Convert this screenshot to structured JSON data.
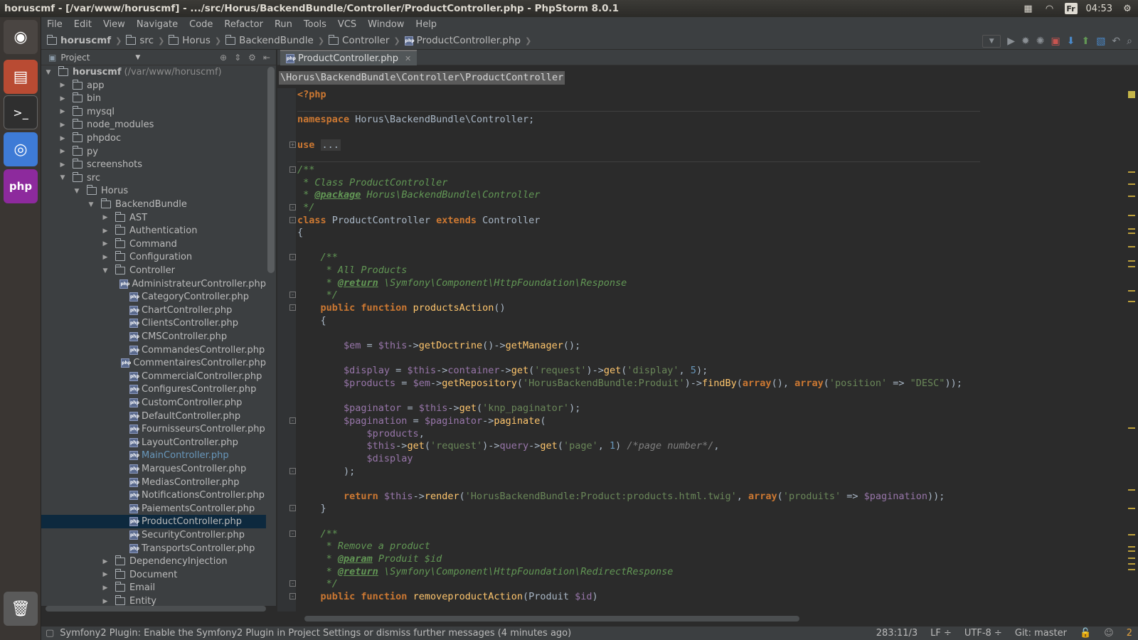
{
  "window": {
    "title": "horuscmf - [/var/www/horuscmf] - .../src/Horus/BackendBundle/Controller/ProductController.php - PhpStorm 8.0.1",
    "clock": "04:53",
    "keyboard": "Fr"
  },
  "menu": [
    "File",
    "Edit",
    "View",
    "Navigate",
    "Code",
    "Refactor",
    "Run",
    "Tools",
    "VCS",
    "Window",
    "Help"
  ],
  "breadcrumbs": [
    "horuscmf",
    "src",
    "Horus",
    "BackendBundle",
    "Controller",
    "ProductController.php"
  ],
  "project": {
    "header": "Project",
    "root_name": "horuscmf",
    "root_path": "(/var/www/horuscmf)"
  },
  "tree": [
    {
      "label": "app",
      "depth": 1,
      "type": "folder",
      "open": false
    },
    {
      "label": "bin",
      "depth": 1,
      "type": "folder",
      "open": false
    },
    {
      "label": "mysql",
      "depth": 1,
      "type": "folder",
      "open": false
    },
    {
      "label": "node_modules",
      "depth": 1,
      "type": "folder",
      "open": false
    },
    {
      "label": "phpdoc",
      "depth": 1,
      "type": "folder",
      "open": false
    },
    {
      "label": "py",
      "depth": 1,
      "type": "folder",
      "open": false
    },
    {
      "label": "screenshots",
      "depth": 1,
      "type": "folder",
      "open": false
    },
    {
      "label": "src",
      "depth": 1,
      "type": "folder",
      "open": true
    },
    {
      "label": "Horus",
      "depth": 2,
      "type": "folder",
      "open": true
    },
    {
      "label": "BackendBundle",
      "depth": 3,
      "type": "folder",
      "open": true
    },
    {
      "label": "AST",
      "depth": 4,
      "type": "folder",
      "open": false
    },
    {
      "label": "Authentication",
      "depth": 4,
      "type": "folder",
      "open": false
    },
    {
      "label": "Command",
      "depth": 4,
      "type": "folder",
      "open": false
    },
    {
      "label": "Configuration",
      "depth": 4,
      "type": "folder",
      "open": false
    },
    {
      "label": "Controller",
      "depth": 4,
      "type": "folder",
      "open": true
    },
    {
      "label": "AdministrateurController.php",
      "depth": 5,
      "type": "file"
    },
    {
      "label": "CategoryController.php",
      "depth": 5,
      "type": "file"
    },
    {
      "label": "ChartController.php",
      "depth": 5,
      "type": "file"
    },
    {
      "label": "ClientsController.php",
      "depth": 5,
      "type": "file"
    },
    {
      "label": "CMSController.php",
      "depth": 5,
      "type": "file"
    },
    {
      "label": "CommandesController.php",
      "depth": 5,
      "type": "file"
    },
    {
      "label": "CommentairesController.php",
      "depth": 5,
      "type": "file"
    },
    {
      "label": "CommercialController.php",
      "depth": 5,
      "type": "file"
    },
    {
      "label": "ConfiguresController.php",
      "depth": 5,
      "type": "file"
    },
    {
      "label": "CustomController.php",
      "depth": 5,
      "type": "file"
    },
    {
      "label": "DefaultController.php",
      "depth": 5,
      "type": "file"
    },
    {
      "label": "FournisseursController.php",
      "depth": 5,
      "type": "file"
    },
    {
      "label": "LayoutController.php",
      "depth": 5,
      "type": "file"
    },
    {
      "label": "MainController.php",
      "depth": 5,
      "type": "file",
      "link": true
    },
    {
      "label": "MarquesController.php",
      "depth": 5,
      "type": "file"
    },
    {
      "label": "MediasController.php",
      "depth": 5,
      "type": "file"
    },
    {
      "label": "NotificationsController.php",
      "depth": 5,
      "type": "file"
    },
    {
      "label": "PaiementsController.php",
      "depth": 5,
      "type": "file"
    },
    {
      "label": "ProductController.php",
      "depth": 5,
      "type": "file",
      "selected": true
    },
    {
      "label": "SecurityController.php",
      "depth": 5,
      "type": "file"
    },
    {
      "label": "TransportsController.php",
      "depth": 5,
      "type": "file"
    },
    {
      "label": "DependencyInjection",
      "depth": 4,
      "type": "folder",
      "open": false
    },
    {
      "label": "Document",
      "depth": 4,
      "type": "folder",
      "open": false
    },
    {
      "label": "Email",
      "depth": 4,
      "type": "folder",
      "open": false
    },
    {
      "label": "Entity",
      "depth": 4,
      "type": "folder",
      "open": false
    }
  ],
  "editor": {
    "tab": "ProductController.php",
    "class_breadcrumb": "\\Horus\\BackendBundle\\Controller\\ProductController",
    "lines": [
      [
        [
          "php",
          "<?php"
        ]
      ],
      [],
      [
        [
          "kw",
          "namespace "
        ],
        [
          "t",
          "Horus\\BackendBundle\\Controller;"
        ]
      ],
      [],
      [
        [
          "kw",
          "use "
        ],
        [
          "fold",
          "..."
        ]
      ],
      [],
      [
        [
          "cm",
          "/**"
        ]
      ],
      [
        [
          "cm",
          " * Class ProductController"
        ]
      ],
      [
        [
          "cm",
          " * "
        ],
        [
          "tag",
          "@package"
        ],
        [
          "cm",
          " Horus\\BackendBundle\\Controller"
        ]
      ],
      [
        [
          "cm",
          " */"
        ]
      ],
      [
        [
          "kw",
          "class "
        ],
        [
          "t",
          "ProductController "
        ],
        [
          "kw",
          "extends "
        ],
        [
          "t",
          "Controller"
        ]
      ],
      [
        [
          "t",
          "{"
        ]
      ],
      [],
      [
        [
          "cm",
          "    /**"
        ]
      ],
      [
        [
          "cm",
          "     * All Products"
        ]
      ],
      [
        [
          "cm",
          "     * "
        ],
        [
          "tag",
          "@return"
        ],
        [
          "cm",
          " \\Symfony\\Component\\HttpFoundation\\Response"
        ]
      ],
      [
        [
          "cm",
          "     */"
        ]
      ],
      [
        [
          "kw",
          "    public function "
        ],
        [
          "fn",
          "productsAction"
        ],
        [
          "t",
          "()"
        ]
      ],
      [
        [
          "t",
          "    {"
        ]
      ],
      [],
      [
        [
          "var",
          "        $em"
        ],
        [
          "t",
          " = "
        ],
        [
          "var",
          "$this"
        ],
        [
          "t",
          "->"
        ],
        [
          "fn",
          "getDoctrine"
        ],
        [
          "t",
          "()->"
        ],
        [
          "fn",
          "getManager"
        ],
        [
          "t",
          "();"
        ]
      ],
      [],
      [
        [
          "var",
          "        $display"
        ],
        [
          "t",
          " = "
        ],
        [
          "var",
          "$this"
        ],
        [
          "t",
          "->"
        ],
        [
          "var",
          "container"
        ],
        [
          "t",
          "->"
        ],
        [
          "fn",
          "get"
        ],
        [
          "t",
          "("
        ],
        [
          "str",
          "'request'"
        ],
        [
          "t",
          ")->"
        ],
        [
          "fn",
          "get"
        ],
        [
          "t",
          "("
        ],
        [
          "str",
          "'display'"
        ],
        [
          "t",
          ", "
        ],
        [
          "num",
          "5"
        ],
        [
          "t",
          ");"
        ]
      ],
      [
        [
          "var",
          "        $products"
        ],
        [
          "t",
          " = "
        ],
        [
          "var",
          "$em"
        ],
        [
          "t",
          "->"
        ],
        [
          "fn",
          "getRepository"
        ],
        [
          "t",
          "("
        ],
        [
          "str",
          "'HorusBackendBundle:Produit'"
        ],
        [
          "t",
          ")->"
        ],
        [
          "fn",
          "findBy"
        ],
        [
          "t",
          "("
        ],
        [
          "kw",
          "array"
        ],
        [
          "t",
          "(), "
        ],
        [
          "kw",
          "array"
        ],
        [
          "t",
          "("
        ],
        [
          "str",
          "'position'"
        ],
        [
          "t",
          " => "
        ],
        [
          "str",
          "\"DESC\""
        ],
        [
          "t",
          "));"
        ]
      ],
      [],
      [
        [
          "var",
          "        $paginator"
        ],
        [
          "t",
          " = "
        ],
        [
          "var",
          "$this"
        ],
        [
          "t",
          "->"
        ],
        [
          "fn",
          "get"
        ],
        [
          "t",
          "("
        ],
        [
          "str",
          "'knp_paginator'"
        ],
        [
          "t",
          ");"
        ]
      ],
      [
        [
          "var",
          "        $pagination"
        ],
        [
          "t",
          " = "
        ],
        [
          "var",
          "$paginator"
        ],
        [
          "t",
          "->"
        ],
        [
          "fn",
          "paginate"
        ],
        [
          "t",
          "("
        ]
      ],
      [
        [
          "var",
          "            $products"
        ],
        [
          "t",
          ","
        ]
      ],
      [
        [
          "var",
          "            $this"
        ],
        [
          "t",
          "->"
        ],
        [
          "fn",
          "get"
        ],
        [
          "t",
          "("
        ],
        [
          "str",
          "'request'"
        ],
        [
          "t",
          ")->"
        ],
        [
          "var",
          "query"
        ],
        [
          "t",
          "->"
        ],
        [
          "fn",
          "get"
        ],
        [
          "t",
          "("
        ],
        [
          "str",
          "'page'"
        ],
        [
          "t",
          ", "
        ],
        [
          "num",
          "1"
        ],
        [
          "t",
          ") "
        ],
        [
          "lc",
          "/*page number*/"
        ],
        [
          "t",
          ","
        ]
      ],
      [
        [
          "var",
          "            $display"
        ]
      ],
      [
        [
          "t",
          "        );"
        ]
      ],
      [],
      [
        [
          "kw",
          "        return "
        ],
        [
          "var",
          "$this"
        ],
        [
          "t",
          "->"
        ],
        [
          "fn",
          "render"
        ],
        [
          "t",
          "("
        ],
        [
          "str",
          "'HorusBackendBundle:Product:products.html.twig'"
        ],
        [
          "t",
          ", "
        ],
        [
          "kw",
          "array"
        ],
        [
          "t",
          "("
        ],
        [
          "str",
          "'produits'"
        ],
        [
          "t",
          " => "
        ],
        [
          "var",
          "$pagination"
        ],
        [
          "t",
          "));"
        ]
      ],
      [
        [
          "t",
          "    }"
        ]
      ],
      [],
      [
        [
          "cm",
          "    /**"
        ]
      ],
      [
        [
          "cm",
          "     * Remove a product"
        ]
      ],
      [
        [
          "cm",
          "     * "
        ],
        [
          "tag",
          "@param"
        ],
        [
          "cm",
          " Produit $id"
        ]
      ],
      [
        [
          "cm",
          "     * "
        ],
        [
          "tag",
          "@return"
        ],
        [
          "cm",
          " \\Symfony\\Component\\HttpFoundation\\RedirectResponse"
        ]
      ],
      [
        [
          "cm",
          "     */"
        ]
      ],
      [
        [
          "kw",
          "    public function "
        ],
        [
          "fn",
          "removeproductAction"
        ],
        [
          "t",
          "(Produit "
        ],
        [
          "var",
          "$id"
        ],
        [
          "t",
          ")"
        ]
      ]
    ]
  },
  "status": {
    "message": "Symfony2 Plugin: Enable the Symfony2 Plugin in Project Settings or dismiss further messages (4 minutes ago)",
    "position": "283:11/3",
    "line_sep": "LF ÷",
    "encoding": "UTF-8 ÷",
    "vcs": "Git: master",
    "notifications": "2"
  },
  "colors": {
    "accent": "#cc7832",
    "selection": "#0d293e",
    "background": "#2b2b2b"
  }
}
